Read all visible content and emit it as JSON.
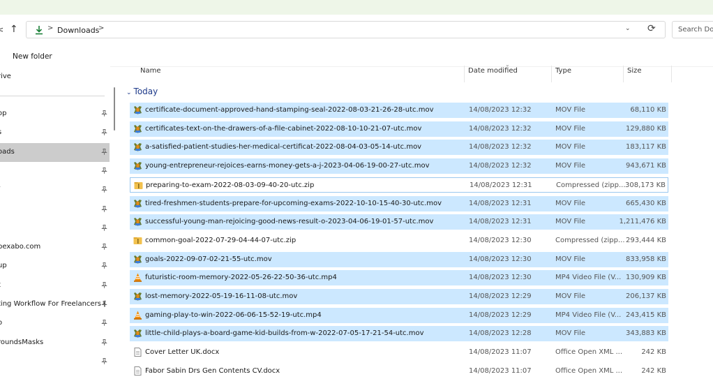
{
  "address_bar": {
    "back_glyph": "<",
    "up_glyph": "↑",
    "separator": ">",
    "crumb": "Downloads",
    "dropdown_glyph": "⌄",
    "refresh_glyph": "⟳"
  },
  "search": {
    "placeholder": "Search Dow"
  },
  "toolbar": {
    "new_folder_label": "New folder"
  },
  "sidebar": {
    "pin_glyph": "📌",
    "items": [
      {
        "label": "rive",
        "pinned": false,
        "selected": false
      },
      {
        "label": "op",
        "pinned": true,
        "selected": false
      },
      {
        "label": "s",
        "pinned": true,
        "selected": false
      },
      {
        "label": "oads",
        "pinned": true,
        "selected": true
      },
      {
        "label": "",
        "pinned": true,
        "selected": false
      },
      {
        "label": "/",
        "pinned": true,
        "selected": false
      },
      {
        "label": "",
        "pinned": true,
        "selected": false
      },
      {
        "label": "",
        "pinned": true,
        "selected": false
      },
      {
        "label": "pexabo.com",
        "pinned": true,
        "selected": false
      },
      {
        "label": "up",
        "pinned": true,
        "selected": false
      },
      {
        "label": "t",
        "pinned": true,
        "selected": false
      },
      {
        "label": "ting Workflow For Freelancers (",
        "pinned": true,
        "selected": false
      },
      {
        "label": "o",
        "pinned": true,
        "selected": false
      },
      {
        "label": "roundsMasks",
        "pinned": true,
        "selected": false
      },
      {
        "label": "",
        "pinned": true,
        "selected": false
      }
    ]
  },
  "columns": {
    "name": "Name",
    "date": "Date modified",
    "type": "Type",
    "size": "Size",
    "sort_glyph": "⌄"
  },
  "group": {
    "chevron": "⌄",
    "label": "Today"
  },
  "files": [
    {
      "name": "certificate-document-approved-hand-stamping-seal-2022-08-03-21-26-28-utc.mov",
      "date": "14/08/2023 12:32",
      "type": "MOV File",
      "size": "68,110 KB",
      "icon": "vlc-media-icon",
      "state": "selected"
    },
    {
      "name": "certificates-text-on-the-drawers-of-a-file-cabinet-2022-08-10-10-21-07-utc.mov",
      "date": "14/08/2023 12:32",
      "type": "MOV File",
      "size": "129,880 KB",
      "icon": "vlc-media-icon",
      "state": "selected"
    },
    {
      "name": "a-satisfied-patient-studies-her-medical-certificat-2022-08-04-03-05-14-utc.mov",
      "date": "14/08/2023 12:32",
      "type": "MOV File",
      "size": "183,117 KB",
      "icon": "vlc-media-icon",
      "state": "selected"
    },
    {
      "name": "young-entrepreneur-rejoices-earns-money-gets-a-j-2023-04-06-19-00-27-utc.mov",
      "date": "14/08/2023 12:32",
      "type": "MOV File",
      "size": "943,671 KB",
      "icon": "vlc-media-icon",
      "state": "selected"
    },
    {
      "name": "preparing-to-exam-2022-08-03-09-40-20-utc.zip",
      "date": "14/08/2023 12:31",
      "type": "Compressed (zipp...",
      "size": "308,173 KB",
      "icon": "zip-folder-icon",
      "state": "focus"
    },
    {
      "name": "tired-freshmen-students-prepare-for-upcoming-exams-2022-10-10-15-40-30-utc.mov",
      "date": "14/08/2023 12:31",
      "type": "MOV File",
      "size": "665,430 KB",
      "icon": "vlc-media-icon",
      "state": "selected"
    },
    {
      "name": "successful-young-man-rejoicing-good-news-result-o-2023-04-06-19-01-57-utc.mov",
      "date": "14/08/2023 12:31",
      "type": "MOV File",
      "size": "1,211,476 KB",
      "icon": "vlc-media-icon",
      "state": "selected"
    },
    {
      "name": "common-goal-2022-07-29-04-44-07-utc.zip",
      "date": "14/08/2023 12:30",
      "type": "Compressed (zipp...",
      "size": "293,444 KB",
      "icon": "zip-folder-icon",
      "state": "none"
    },
    {
      "name": "goals-2022-09-07-02-21-55-utc.mov",
      "date": "14/08/2023 12:30",
      "type": "MOV File",
      "size": "833,958 KB",
      "icon": "vlc-media-icon",
      "state": "selected"
    },
    {
      "name": "futuristic-room-memory-2022-05-26-22-50-36-utc.mp4",
      "date": "14/08/2023 12:30",
      "type": "MP4 Video File (V...",
      "size": "130,909 KB",
      "icon": "vlc-cone-icon",
      "state": "selected"
    },
    {
      "name": "lost-memory-2022-05-19-16-11-08-utc.mov",
      "date": "14/08/2023 12:29",
      "type": "MOV File",
      "size": "206,137 KB",
      "icon": "vlc-media-icon",
      "state": "selected"
    },
    {
      "name": "gaming-play-to-win-2022-06-06-15-52-19-utc.mp4",
      "date": "14/08/2023 12:29",
      "type": "MP4 Video File (V...",
      "size": "243,415 KB",
      "icon": "vlc-cone-icon",
      "state": "selected"
    },
    {
      "name": "little-child-plays-a-board-game-kid-builds-from-w-2022-07-05-17-21-54-utc.mov",
      "date": "14/08/2023 12:28",
      "type": "MOV File",
      "size": "343,883 KB",
      "icon": "vlc-media-icon",
      "state": "selected"
    },
    {
      "name": "Cover Letter UK.docx",
      "date": "14/08/2023 11:07",
      "type": "Office Open XML ...",
      "size": "242 KB",
      "icon": "document-icon",
      "state": "none"
    },
    {
      "name": "Fabor Sabin Drs Gen Contents CV.docx",
      "date": "14/08/2023 11:07",
      "type": "Office Open XML ...",
      "size": "242 KB",
      "icon": "document-icon",
      "state": "none"
    }
  ]
}
